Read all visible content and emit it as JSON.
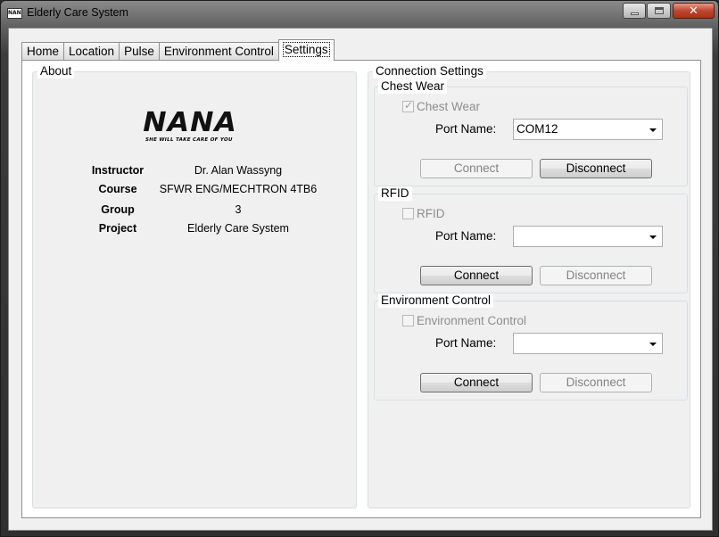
{
  "window": {
    "title": "Elderly Care System",
    "icon_text": "NANA"
  },
  "tabs": [
    {
      "label": "Home"
    },
    {
      "label": "Location"
    },
    {
      "label": "Pulse"
    },
    {
      "label": "Environment Control"
    },
    {
      "label": "Settings",
      "active": true
    }
  ],
  "about": {
    "legend": "About",
    "logo_text": "NANA",
    "logo_tagline": "SHE WILL TAKE CARE OF YOU",
    "rows": [
      {
        "label": "Instructor",
        "value": "Dr. Alan Wassyng"
      },
      {
        "label": "Course",
        "value": "SFWR ENG/MECHTRON 4TB6"
      },
      {
        "label": "Group",
        "value": "3"
      },
      {
        "label": "Project",
        "value": "Elderly Care System"
      }
    ]
  },
  "connection": {
    "legend": "Connection Settings",
    "groups": [
      {
        "legend": "Chest Wear",
        "checkbox_label": "Chest Wear",
        "checked": true,
        "port_label": "Port Name:",
        "port_value": "COM12",
        "connect_label": "Connect",
        "disconnect_label": "Disconnect"
      },
      {
        "legend": "RFID",
        "checkbox_label": "RFID",
        "checked": false,
        "port_label": "Port Name:",
        "port_value": "",
        "connect_label": "Connect",
        "disconnect_label": "Disconnect"
      },
      {
        "legend": "Environment Control",
        "checkbox_label": "Environment Control",
        "checked": false,
        "port_label": "Port Name:",
        "port_value": "",
        "connect_label": "Connect",
        "disconnect_label": "Disconnect"
      }
    ]
  }
}
